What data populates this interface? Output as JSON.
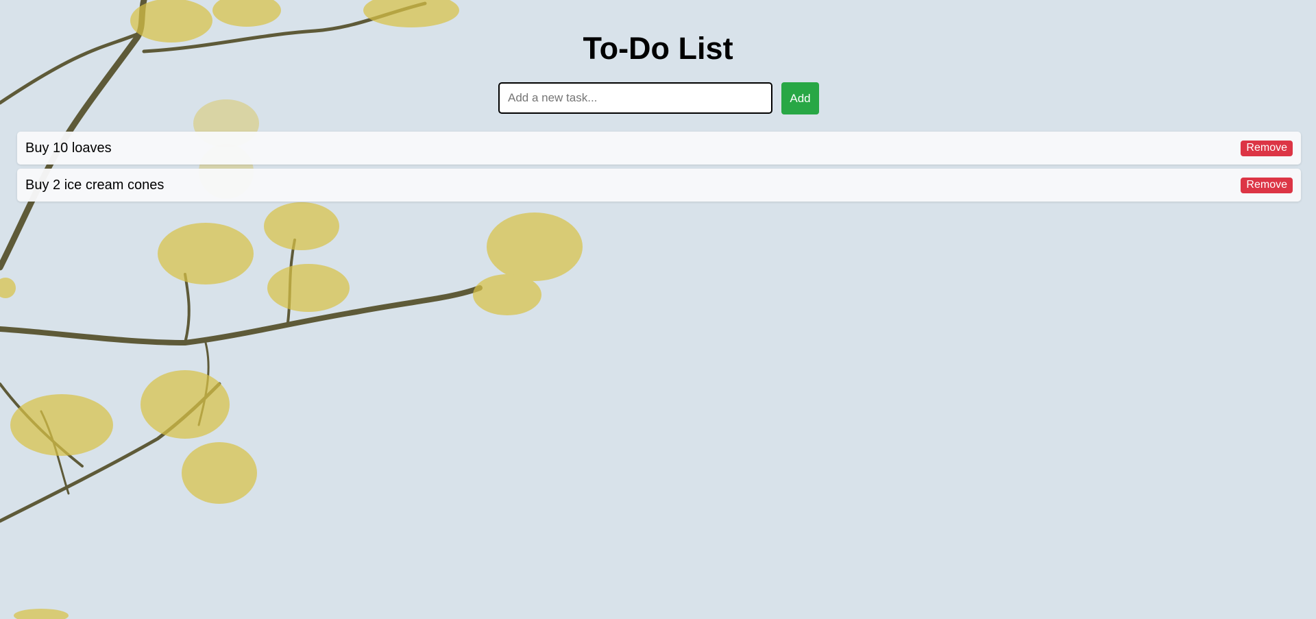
{
  "header": {
    "title": "To-Do List"
  },
  "input": {
    "placeholder": "Add a new task...",
    "value": ""
  },
  "actions": {
    "add_label": "Add"
  },
  "tasks": [
    {
      "text": "Buy 10 loaves",
      "remove_label": "Remove"
    },
    {
      "text": "Buy 2 ice cream cones",
      "remove_label": "Remove"
    }
  ],
  "colors": {
    "background": "#d8e2ea",
    "add_button": "#28a745",
    "remove_button": "#dc3545",
    "blossom": "#d9c248",
    "branch": "#5e5a38"
  },
  "background_image": "yellow-blossom-branch"
}
